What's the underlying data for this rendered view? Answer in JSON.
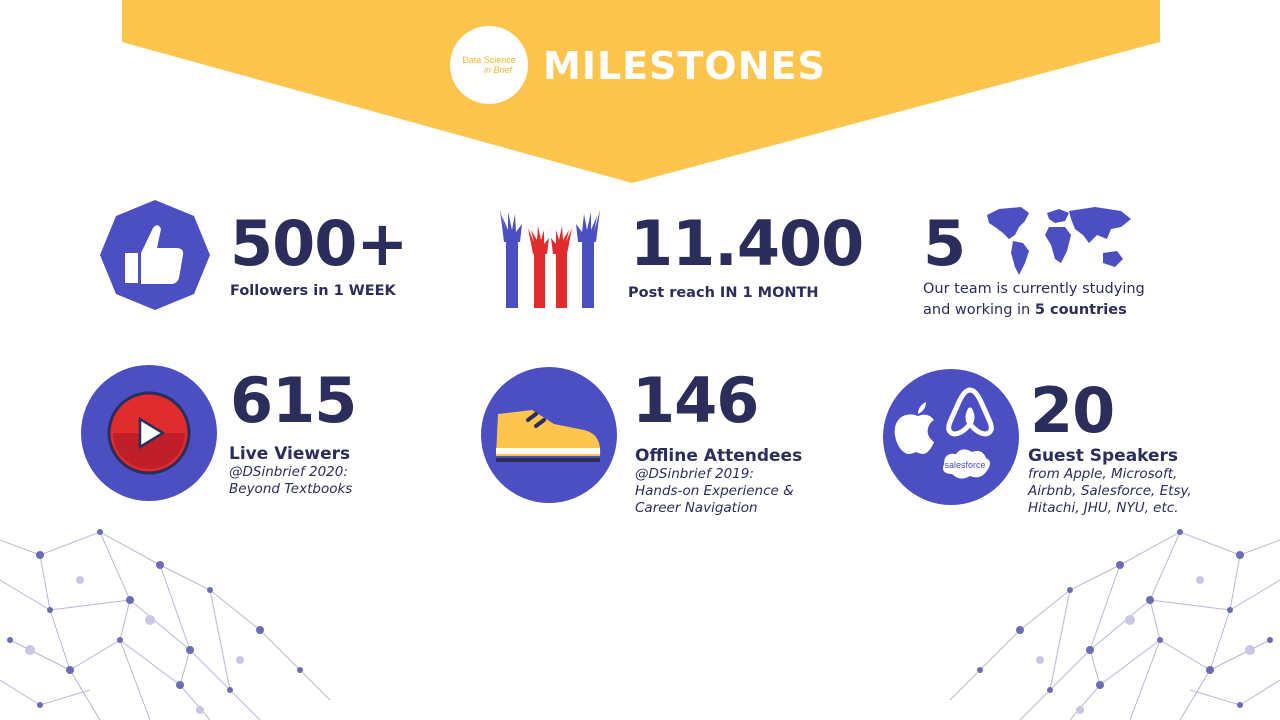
{
  "header": {
    "title": "MILESTONES",
    "logo_line1": "Data Science",
    "logo_line2": "in Brief"
  },
  "stats": [
    {
      "value": "500+",
      "label": "Followers in 1 WEEK",
      "icon": "thumbs-up-icon"
    },
    {
      "value": "11.400",
      "label": "Post reach IN 1 MONTH",
      "icon": "raised-hands-icon"
    },
    {
      "value": "5",
      "desc_prefix": "Our team is currently studying and working in ",
      "desc_bold": "5 countries",
      "icon": "world-map-icon"
    },
    {
      "value": "615",
      "label": "Live Viewers",
      "detail_line1": "@DSinbrief 2020:",
      "detail_line2": "Beyond Textbooks",
      "icon": "play-button-icon"
    },
    {
      "value": "146",
      "label": "Offline Attendees",
      "detail_line1": "@DSinbrief 2019:",
      "detail_line2": "Hands-on Experience &",
      "detail_line3": "Career Navigation",
      "icon": "sneaker-icon"
    },
    {
      "value": "20",
      "label": "Guest Speakers",
      "detail_line1": "from Apple, Microsoft,",
      "detail_line2": "Airbnb, Salesforce, Etsy,",
      "detail_line3": "Hitachi, JHU, NYU, etc.",
      "icon": "company-logos-icon",
      "logo_text": "salesforce"
    }
  ],
  "colors": {
    "banner": "#fdc54e",
    "primary": "#4b4fc2",
    "text": "#2b2d5b",
    "red": "#e02c2c"
  }
}
